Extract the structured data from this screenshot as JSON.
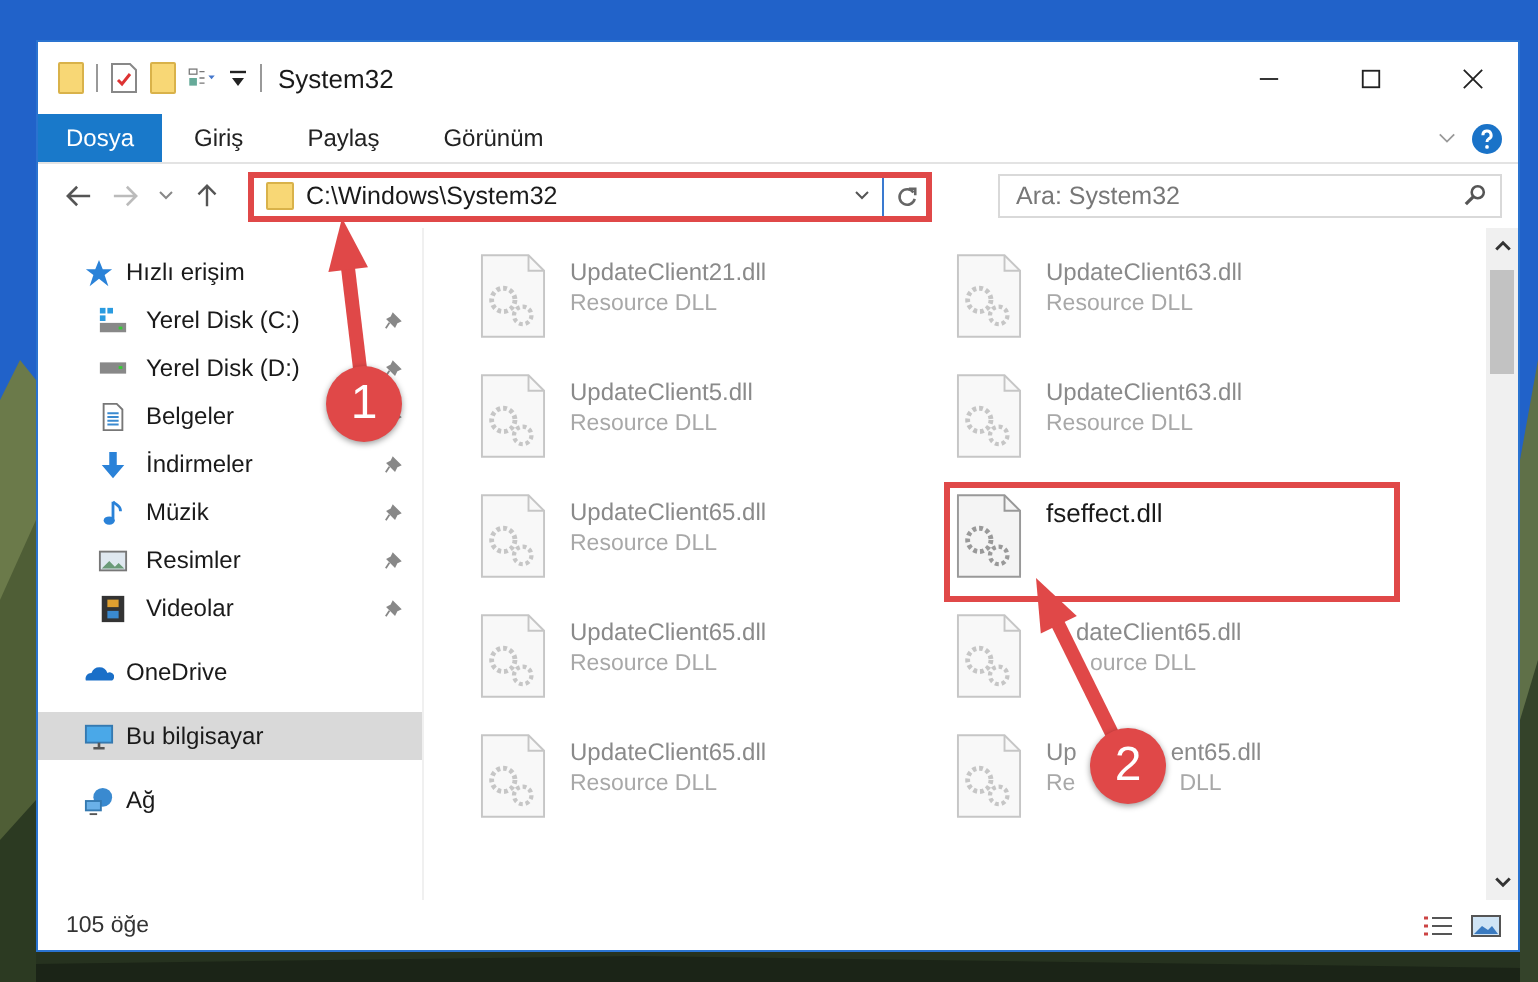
{
  "window": {
    "title": "System32"
  },
  "ribbon_tabs": [
    {
      "label": "Dosya",
      "selected": true
    },
    {
      "label": "Giriş",
      "selected": false
    },
    {
      "label": "Paylaş",
      "selected": false
    },
    {
      "label": "Görünüm",
      "selected": false
    }
  ],
  "address_bar": {
    "path": "C:\\Windows\\System32",
    "highlighted": true
  },
  "search": {
    "placeholder": "Ara: System32"
  },
  "sidebar": {
    "items": [
      {
        "kind": "quick",
        "label": "Hızlı erişim",
        "selected": false,
        "pinned": false,
        "children": [
          {
            "kind": "drive-c",
            "label": "Yerel Disk (C:)",
            "selected": false,
            "pinned": true
          },
          {
            "kind": "drive",
            "label": "Yerel Disk (D:)",
            "selected": false,
            "pinned": true
          },
          {
            "kind": "documents",
            "label": "Belgeler",
            "selected": false,
            "pinned": true
          },
          {
            "kind": "downloads",
            "label": "İndirmeler",
            "selected": false,
            "pinned": true
          },
          {
            "kind": "music",
            "label": "Müzik",
            "selected": false,
            "pinned": true
          },
          {
            "kind": "pictures",
            "label": "Resimler",
            "selected": false,
            "pinned": true
          },
          {
            "kind": "videos",
            "label": "Videolar",
            "selected": false,
            "pinned": true
          }
        ]
      },
      {
        "kind": "cloud",
        "label": "OneDrive",
        "selected": false,
        "pinned": false
      },
      {
        "kind": "computer",
        "label": "Bu bilgisayar",
        "selected": true,
        "pinned": false
      },
      {
        "kind": "network",
        "label": "Ağ",
        "selected": false,
        "pinned": false
      }
    ]
  },
  "files": [
    {
      "kind": "file",
      "name": "UpdateClient21.dll",
      "type": "Resource DLL",
      "faded": true,
      "highlighted": false
    },
    {
      "kind": "file",
      "name": "UpdateClient63.dll",
      "type": "Resource DLL",
      "faded": true,
      "highlighted": false
    },
    {
      "kind": "file",
      "name": "UpdateClient5.dll",
      "type": "Resource DLL",
      "faded": true,
      "highlighted": false
    },
    {
      "kind": "file",
      "name": "UpdateClient63.dll",
      "type": "Resource DLL",
      "faded": true,
      "highlighted": false
    },
    {
      "kind": "file",
      "name": "UpdateClient65.dll",
      "type": "Resource DLL",
      "faded": true,
      "highlighted": false
    },
    {
      "kind": "file",
      "name": "fseffect.dll",
      "faded": false,
      "highlighted": true
    },
    {
      "kind": "file",
      "name": "UpdateClient65.dll",
      "type": "Resource DLL",
      "faded": true,
      "highlighted": false
    },
    {
      "kind": "covered-start",
      "name": "dateClient65.dll",
      "type": "ource DLL",
      "faded": true,
      "highlighted": false
    },
    {
      "kind": "file",
      "name": "UpdateClient65.dll",
      "type": "Resource DLL",
      "faded": true,
      "highlighted": false
    },
    {
      "kind": "covered-middle",
      "name_parts": [
        "Up",
        "ent65.dll"
      ],
      "type_parts": [
        "Re",
        "DLL"
      ],
      "faded": true,
      "highlighted": false
    }
  ],
  "status_bar": {
    "item_count": "105 öğe"
  },
  "annotations": [
    {
      "number": "1"
    },
    {
      "number": "2"
    }
  ]
}
